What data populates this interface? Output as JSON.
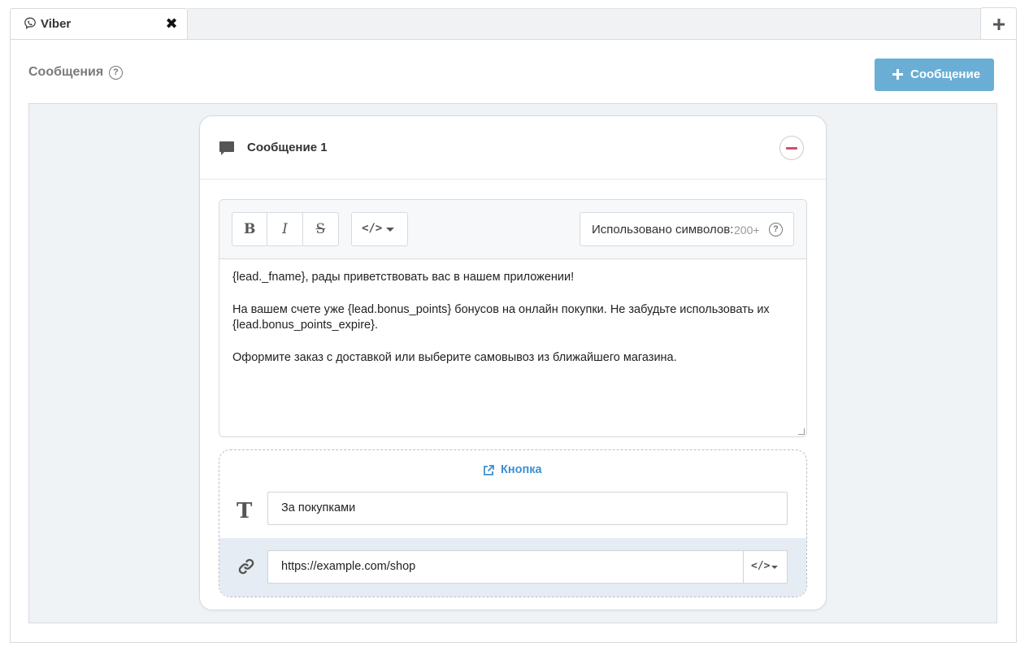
{
  "tabs": {
    "active_tab_label": "Viber",
    "active_tab_icon": "viber-icon",
    "close_icon": "close-icon",
    "add_icon": "plus-icon"
  },
  "header": {
    "title": "Сообщения",
    "help_icon": "question-circle-icon",
    "help_glyph": "?",
    "add_message_label": "Сообщение"
  },
  "message": {
    "title": "Сообщение 1",
    "icon": "chat-icon",
    "remove_icon": "minus-circle-icon",
    "toolbar": {
      "bold": "B",
      "italic": "I",
      "strike": "S",
      "variables_label": "</>",
      "counter_label": "Использовано символов:",
      "counter_value": "200+",
      "counter_help": "?"
    },
    "text_lines": [
      "{lead._fname}, рады приветствовать вас в нашем приложении!",
      "На вашем счете уже {lead.bonus_points} бонусов на онлайн покупки. Не забудьте использовать их",
      "{lead.bonus_points_expire}.",
      "Оформите заказ с доставкой или выберите самовывоз из ближайшего магазина."
    ],
    "button_block": {
      "title": "Кнопка",
      "text_value": "За покупками",
      "url_value": "https://example.com/shop",
      "url_var_label": "</>"
    }
  },
  "colors": {
    "accent_button": "#6aaed6",
    "link_blue": "#3f8fd2",
    "remove_red": "#c8526e",
    "workspace_bg": "#eff3f6"
  }
}
